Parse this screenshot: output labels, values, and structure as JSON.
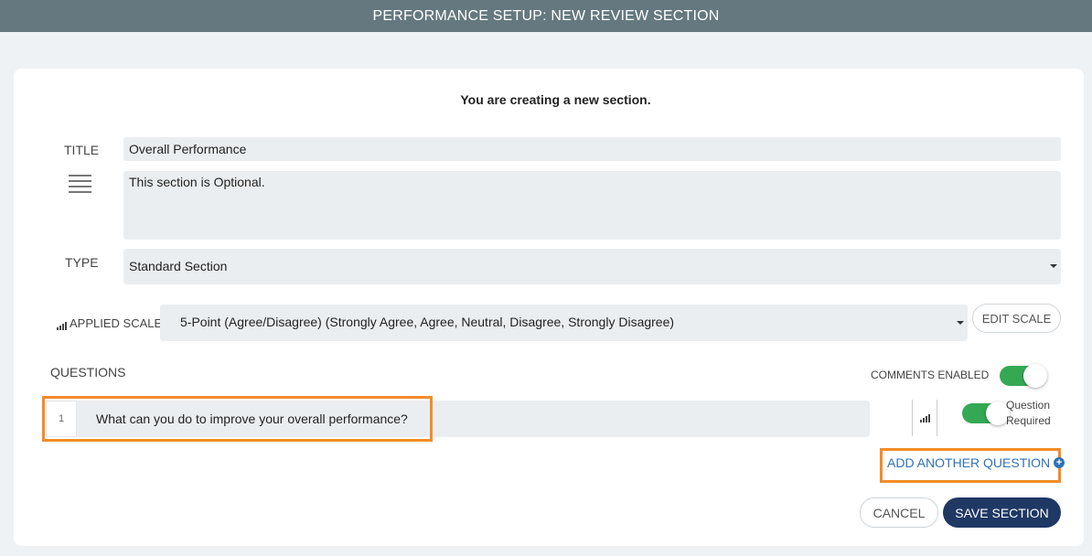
{
  "header": {
    "title": "PERFORMANCE SETUP: NEW REVIEW SECTION"
  },
  "form": {
    "heading": "You are creating a new section.",
    "title_label": "TITLE",
    "title_value": "Overall Performance",
    "description_icon": "menu-lines-icon",
    "description_value": "This section is Optional.",
    "type_label": "TYPE",
    "type_value": "Standard Section",
    "scale_label": "APPLIED SCALE",
    "scale_value": "5-Point (Agree/Disagree) (Strongly Agree, Agree, Neutral, Disagree, Strongly Disagree)",
    "edit_scale_label": "EDIT SCALE"
  },
  "questions": {
    "label": "QUESTIONS",
    "comments_enabled_label": "COMMENTS ENABLED",
    "comments_enabled": true,
    "items": [
      {
        "number": "1",
        "text": "What can you do to improve your overall performance?",
        "required_label_line1": "Question",
        "required_label_line2": "Required",
        "required": true
      }
    ],
    "add_question_label": "ADD ANOTHER QUESTION"
  },
  "actions": {
    "cancel_label": "CANCEL",
    "save_label": "SAVE SECTION"
  },
  "colors": {
    "header_bg": "#657880",
    "toggle_on": "#34a853",
    "primary": "#1f3864",
    "link": "#2e73b8",
    "highlight": "#f28c28"
  }
}
